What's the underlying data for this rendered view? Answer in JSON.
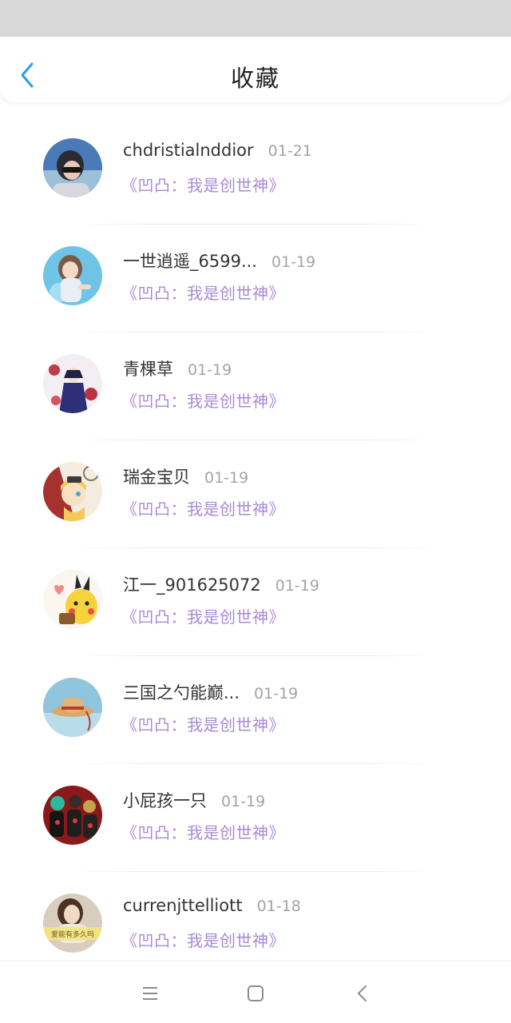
{
  "header": {
    "title": "收藏"
  },
  "items": [
    {
      "username": "chdristialnddior",
      "date": "01-21",
      "book": "《凹凸：我是创世神》"
    },
    {
      "username": "一世逍遥_6599...",
      "date": "01-19",
      "book": "《凹凸：我是创世神》"
    },
    {
      "username": "青棵草",
      "date": "01-19",
      "book": "《凹凸：我是创世神》"
    },
    {
      "username": "瑞金宝贝",
      "date": "01-19",
      "book": "《凹凸：我是创世神》"
    },
    {
      "username": "江一_901625072",
      "date": "01-19",
      "book": "《凹凸：我是创世神》"
    },
    {
      "username": "三国之勺能巅...",
      "date": "01-19",
      "book": "《凹凸：我是创世神》"
    },
    {
      "username": "小屁孩一只",
      "date": "01-19",
      "book": "《凹凸：我是创世神》"
    },
    {
      "username": "currenjttelliott",
      "date": "01-18",
      "book": "《凹凸：我是创世神》"
    }
  ],
  "avatar_art": {
    "item8_caption": "爱能有多久吗"
  },
  "colors": {
    "accent": "#2a9df4",
    "book_title": "#a98ad6",
    "date": "#a4a4a4"
  },
  "icons": {
    "back": "chevron-left-icon",
    "nav_menu": "menu-icon",
    "nav_home": "square-icon",
    "nav_back": "triangle-back-icon"
  }
}
